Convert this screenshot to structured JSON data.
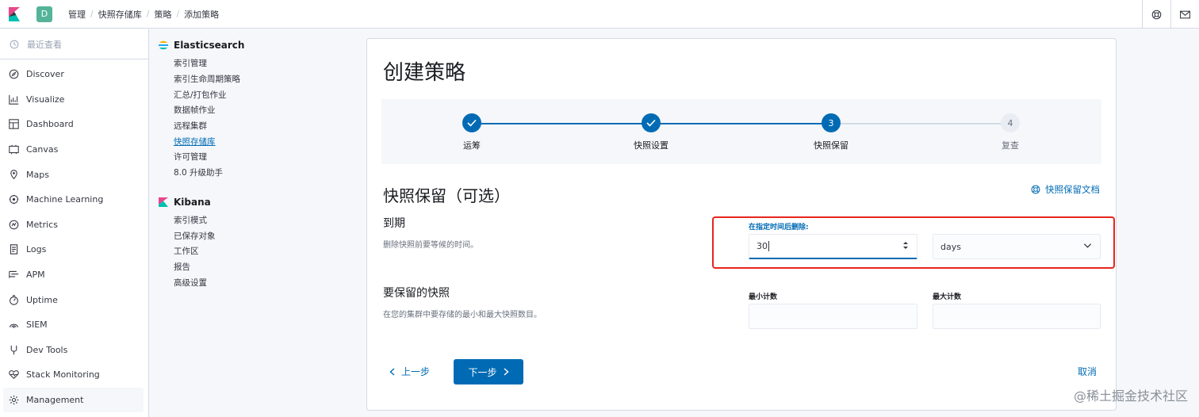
{
  "header": {
    "space_initial": "D",
    "breadcrumbs": [
      "管理",
      "快照存储库",
      "策略",
      "添加策略"
    ]
  },
  "leftnav": {
    "recent": "最近查看",
    "items": [
      {
        "label": "Discover",
        "icon": "compass-icon"
      },
      {
        "label": "Visualize",
        "icon": "chart-icon"
      },
      {
        "label": "Dashboard",
        "icon": "dashboard-icon"
      },
      {
        "label": "Canvas",
        "icon": "canvas-icon"
      },
      {
        "label": "Maps",
        "icon": "maps-icon"
      },
      {
        "label": "Machine Learning",
        "icon": "ml-icon"
      },
      {
        "label": "Metrics",
        "icon": "metrics-icon"
      },
      {
        "label": "Logs",
        "icon": "logs-icon"
      },
      {
        "label": "APM",
        "icon": "apm-icon"
      },
      {
        "label": "Uptime",
        "icon": "uptime-icon"
      },
      {
        "label": "SIEM",
        "icon": "siem-icon"
      },
      {
        "label": "Dev Tools",
        "icon": "devtools-icon"
      },
      {
        "label": "Stack Monitoring",
        "icon": "monitoring-icon"
      },
      {
        "label": "Management",
        "icon": "gear-icon",
        "active": true
      }
    ]
  },
  "subnav": {
    "elasticsearch": {
      "title": "Elasticsearch",
      "links": [
        "索引管理",
        "索引生命周期策略",
        "汇总/打包作业",
        "数据帧作业",
        "远程集群",
        "快照存储库",
        "许可管理",
        "8.0 升级助手"
      ],
      "active": "快照存储库"
    },
    "kibana": {
      "title": "Kibana",
      "links": [
        "索引模式",
        "已保存对象",
        "工作区",
        "报告",
        "高级设置"
      ]
    }
  },
  "main": {
    "title": "创建策略",
    "steps": [
      {
        "label": "运筹",
        "state": "complete"
      },
      {
        "label": "快照设置",
        "state": "complete"
      },
      {
        "label": "快照保留",
        "state": "current",
        "number": "3"
      },
      {
        "label": "复查",
        "state": "todo",
        "number": "4"
      }
    ],
    "section_title": "快照保留（可选）",
    "doc_link": "快照保留文档",
    "expiration": {
      "title": "到期",
      "description": "删除快照前要等候的时间。",
      "field_label": "在指定时间后删除:",
      "value": "30",
      "unit": "days"
    },
    "retain": {
      "title": "要保留的快照",
      "description": "在您的集群中要存储的最小和最大快照数目。",
      "min_label": "最小计数",
      "max_label": "最大计数",
      "min_value": "",
      "max_value": ""
    },
    "buttons": {
      "back": "上一步",
      "next": "下一步",
      "cancel": "取消"
    }
  },
  "watermark": "@稀土掘金技术社区",
  "colors": {
    "primary": "#006bb4",
    "highlight_border": "#e7251e",
    "avatar": "#54b399"
  }
}
